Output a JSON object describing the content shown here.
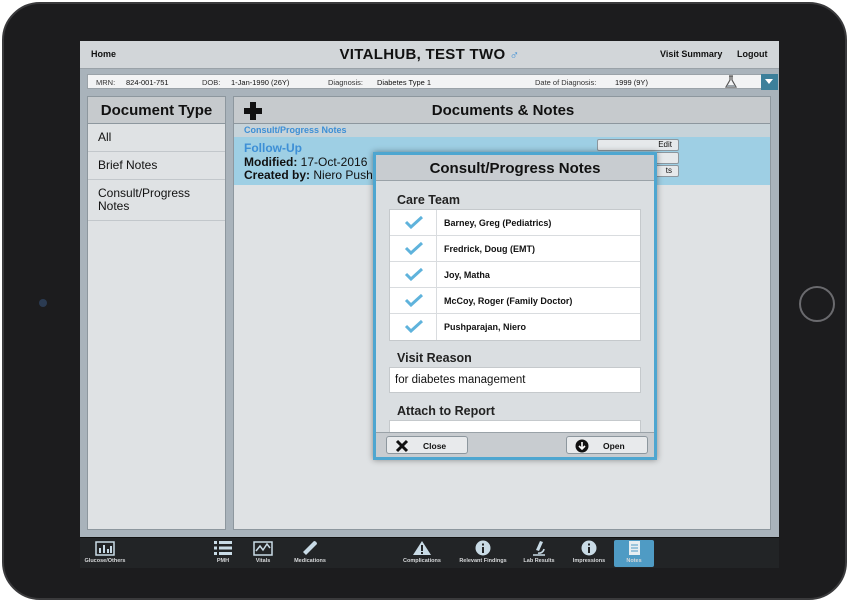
{
  "header": {
    "home": "Home",
    "title": "VITALHUB, TEST TWO",
    "sex_symbol": "♂",
    "visit_summary": "Visit Summary",
    "logout": "Logout"
  },
  "patient": {
    "mrn_label": "MRN:",
    "mrn": "824-001-751",
    "dob_label": "DOB:",
    "dob": "1-Jan-1990 (26Y)",
    "diagnosis_label": "Diagnosis:",
    "diagnosis": "Diabetes Type 1",
    "date_of_diagnosis_label": "Date of Diagnosis:",
    "date_of_diagnosis": "1999 (9Y)"
  },
  "document_type": {
    "title": "Document Type",
    "items": [
      "All",
      "Brief Notes",
      "Consult/Progress Notes"
    ]
  },
  "documents": {
    "title": "Documents & Notes",
    "group": "Consult/Progress Notes",
    "note_title": "Follow-Up",
    "modified_label": "Modified:",
    "modified": "17-Oct-2016",
    "created_label": "Created by:",
    "created_by": "Niero Push",
    "mini_buttons": [
      "Edit",
      "",
      "ts"
    ]
  },
  "modal": {
    "title": "Consult/Progress Notes",
    "care_team_label": "Care Team",
    "care_team": [
      "Barney, Greg (Pediatrics)",
      "Fredrick, Doug (EMT)",
      "Joy, Matha",
      "McCoy, Roger (Family Doctor)",
      "Pushparajan, Niero"
    ],
    "visit_reason_label": "Visit Reason",
    "visit_reason": "for diabetes management",
    "attach_label": "Attach to Report",
    "close": "Close",
    "open": "Open"
  },
  "toolbar": {
    "items": [
      "PMH",
      "Vitals",
      "Medications",
      "Glucose/Others",
      "Complications",
      "Relevant Findings",
      "Lab Results",
      "Impressions",
      "Notes"
    ],
    "active": "Notes"
  },
  "colors": {
    "accent": "#3d8fd6",
    "modal_border": "#4ea6d0",
    "selected_row": "#9ecfe4",
    "toolbar_active": "#4f9bc4"
  }
}
